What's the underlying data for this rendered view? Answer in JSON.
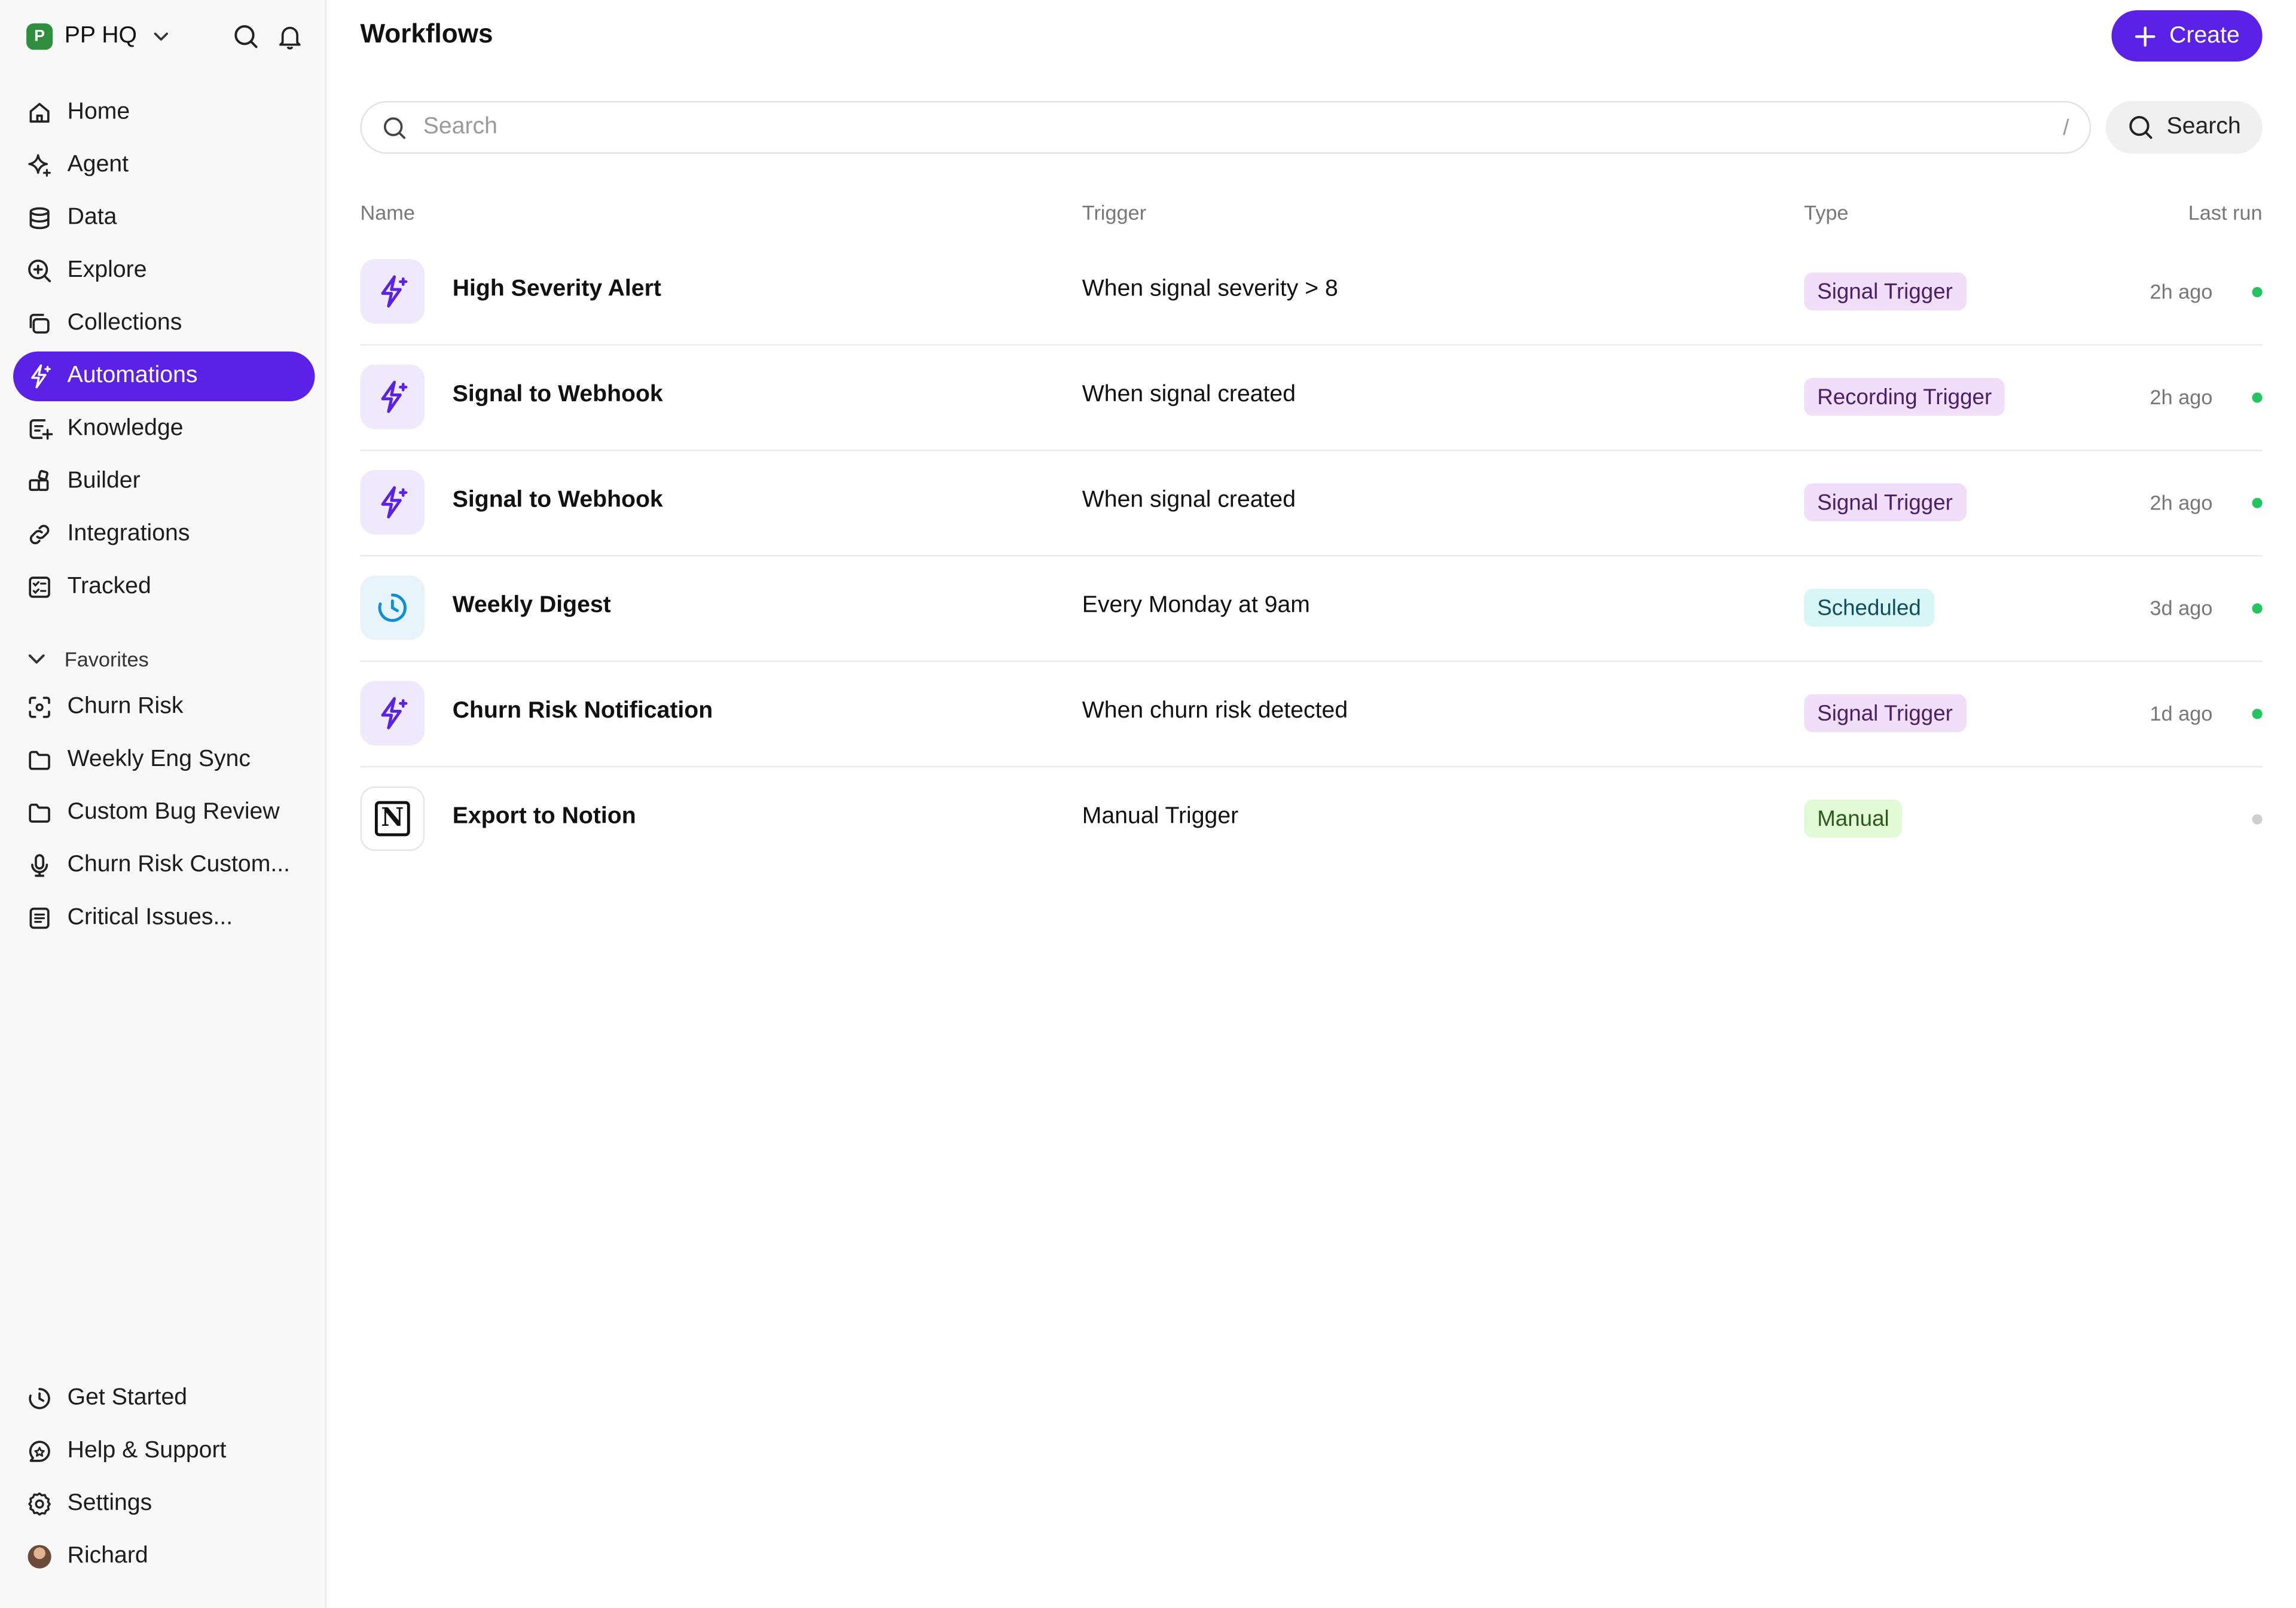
{
  "workspace": {
    "name": "PP HQ",
    "logo_letter": "P"
  },
  "sidebar": {
    "nav": [
      {
        "label": "Home",
        "icon": "home-icon"
      },
      {
        "label": "Agent",
        "icon": "sparkle-icon"
      },
      {
        "label": "Data",
        "icon": "database-icon"
      },
      {
        "label": "Explore",
        "icon": "zoom-in-icon"
      },
      {
        "label": "Collections",
        "icon": "collections-icon"
      },
      {
        "label": "Automations",
        "icon": "bolt-sparkle-icon",
        "active": true
      },
      {
        "label": "Knowledge",
        "icon": "knowledge-icon"
      },
      {
        "label": "Builder",
        "icon": "builder-icon"
      },
      {
        "label": "Integrations",
        "icon": "link-icon"
      },
      {
        "label": "Tracked",
        "icon": "checklist-icon"
      }
    ],
    "favorites_label": "Favorites",
    "favorites": [
      {
        "label": "Churn Risk",
        "icon": "scan-icon"
      },
      {
        "label": "Weekly Eng Sync",
        "icon": "folder-icon"
      },
      {
        "label": "Custom Bug Review",
        "icon": "folder-icon"
      },
      {
        "label": "Churn Risk Custom...",
        "icon": "microphone-icon"
      },
      {
        "label": "Critical Issues...",
        "icon": "document-icon"
      }
    ],
    "bottom": [
      {
        "label": "Get Started",
        "icon": "clock-icon"
      },
      {
        "label": "Help & Support",
        "icon": "chat-icon"
      },
      {
        "label": "Settings",
        "icon": "gear-icon"
      },
      {
        "label": "Richard",
        "icon": "avatar"
      }
    ]
  },
  "main": {
    "title": "Workflows",
    "create_label": "Create",
    "search": {
      "placeholder": "Search",
      "shortcut": "/",
      "button_label": "Search"
    },
    "columns": {
      "name": "Name",
      "trigger": "Trigger",
      "type": "Type",
      "last_run": "Last run"
    },
    "rows": [
      {
        "name": "High Severity Alert",
        "trigger": "When signal severity > 8",
        "type": "Signal Trigger",
        "last_run": "2h ago",
        "icon": "bolt-sparkle-icon",
        "active": true
      },
      {
        "name": "Signal to Webhook",
        "trigger": "When signal created",
        "type": "Recording Trigger",
        "last_run": "2h ago",
        "icon": "bolt-sparkle-icon",
        "active": true
      },
      {
        "name": "Signal to Webhook",
        "trigger": "When signal created",
        "type": "Signal Trigger",
        "last_run": "2h ago",
        "icon": "bolt-sparkle-icon",
        "active": true
      },
      {
        "name": "Weekly Digest",
        "trigger": "Every Monday at 9am",
        "type": "Scheduled",
        "last_run": "3d ago",
        "icon": "clock-icon",
        "active": true
      },
      {
        "name": "Churn Risk Notification",
        "trigger": "When churn risk detected",
        "type": "Signal Trigger",
        "last_run": "1d ago",
        "icon": "bolt-sparkle-icon",
        "active": true
      },
      {
        "name": "Export to Notion",
        "trigger": "Manual Trigger",
        "type": "Manual",
        "last_run": "",
        "icon": "notion-icon",
        "active": false
      }
    ]
  },
  "colors": {
    "accent": "#5b21e6",
    "signal_badge": "#f1def9",
    "scheduled_badge": "#d8f6f8",
    "manual_badge": "#e2fad6",
    "status_active": "#22c55e",
    "status_inactive": "#cfcfcf"
  }
}
